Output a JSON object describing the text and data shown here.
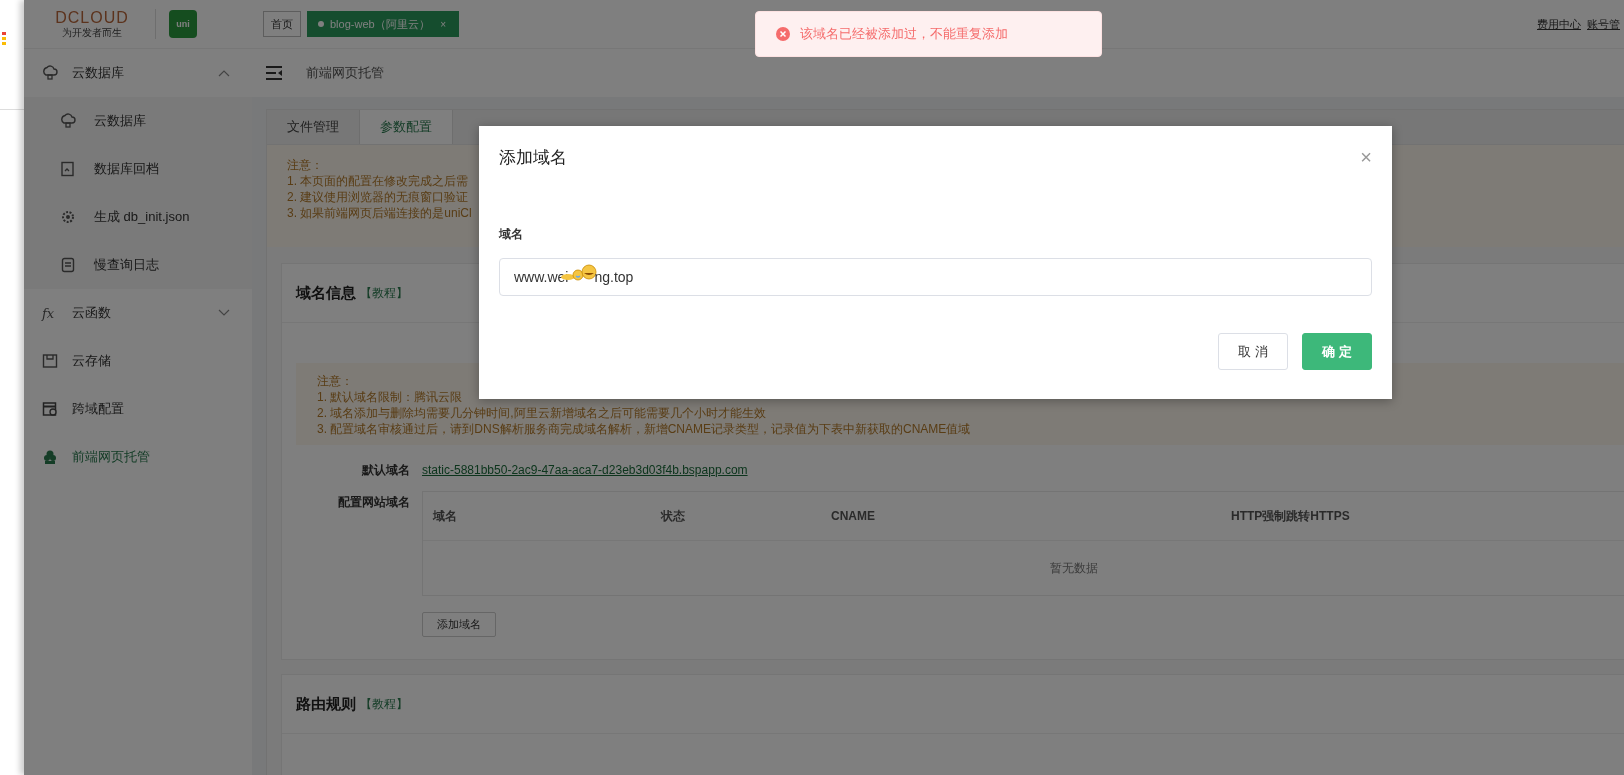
{
  "header": {
    "logo_text": "DCLOUD",
    "logo_tagline": "为开发者而生",
    "app_badge": "uni",
    "tabs": [
      {
        "label": "首页",
        "selected": false
      },
      {
        "label": "blog-web（阿里云）",
        "selected": true,
        "close": "×"
      }
    ],
    "links": [
      "费用中心",
      "账号管"
    ]
  },
  "sidebar": {
    "items": [
      {
        "label": "云数据库",
        "kind": "cloud",
        "expanded": true,
        "selected": false,
        "children": [
          {
            "label": "云数据库",
            "kind": "cloud",
            "selected": false
          },
          {
            "label": "数据库回档",
            "kind": "restore",
            "selected": false
          },
          {
            "label": "生成 db_init.json",
            "kind": "gear",
            "selected": false
          },
          {
            "label": "慢查询日志",
            "kind": "log",
            "selected": false
          }
        ]
      },
      {
        "label": "云函数",
        "kind": "fx",
        "icon_text": "fx",
        "expanded": false,
        "selected": false
      },
      {
        "label": "云存储",
        "kind": "storage",
        "selected": false
      },
      {
        "label": "跨域配置",
        "kind": "cross",
        "selected": false
      },
      {
        "label": "前端网页托管",
        "kind": "host",
        "selected": true
      }
    ]
  },
  "breadcrumb": "前端网页托管",
  "page_tabs": [
    {
      "label": "文件管理",
      "selected": false
    },
    {
      "label": "参数配置",
      "selected": true
    }
  ],
  "notice": {
    "title": "注意：",
    "lines": [
      "1. 本页面的配置在修改完成之后需",
      "2. 建议使用浏览器的无痕窗口验证",
      "3. 如果前端网页后端连接的是uniCl"
    ]
  },
  "domain_card": {
    "title": "域名信息",
    "link": "【教程】",
    "notice": {
      "title": "注意：",
      "lines": [
        "1. 默认域名限制：腾讯云限",
        "2. 域名添加与删除均需要几分钟时间,阿里云新增域名之后可能需要几个小时才能生效",
        "3. 配置域名审核通过后，请到DNS解析服务商完成域名解析，新增CNAME记录类型，记录值为下表中新获取的CNAME值域"
      ]
    },
    "default_domain": {
      "label": "默认域名",
      "value": "static-5881bb50-2ac9-47aa-aca7-d23eb3d03f4b.bspapp.com"
    },
    "site_domains": {
      "label": "配置网站域名",
      "columns": [
        "域名",
        "状态",
        "CNAME",
        "HTTP强制跳转HTTPS"
      ],
      "empty_text": "暂无数据"
    },
    "add_button": "添加域名"
  },
  "route_card": {
    "title": "路由规则",
    "link": "【教程】"
  },
  "modal": {
    "title": "添加域名",
    "close": "×",
    "field": {
      "label": "域名",
      "value_before": "www.wei",
      "value_after": "ng.top"
    },
    "buttons": [
      {
        "label": "取 消",
        "kind": "default"
      },
      {
        "label": "确 定",
        "kind": "primary"
      }
    ]
  },
  "toast": {
    "kind": "error",
    "message": "该域名已经被添加过，不能重复添加"
  }
}
